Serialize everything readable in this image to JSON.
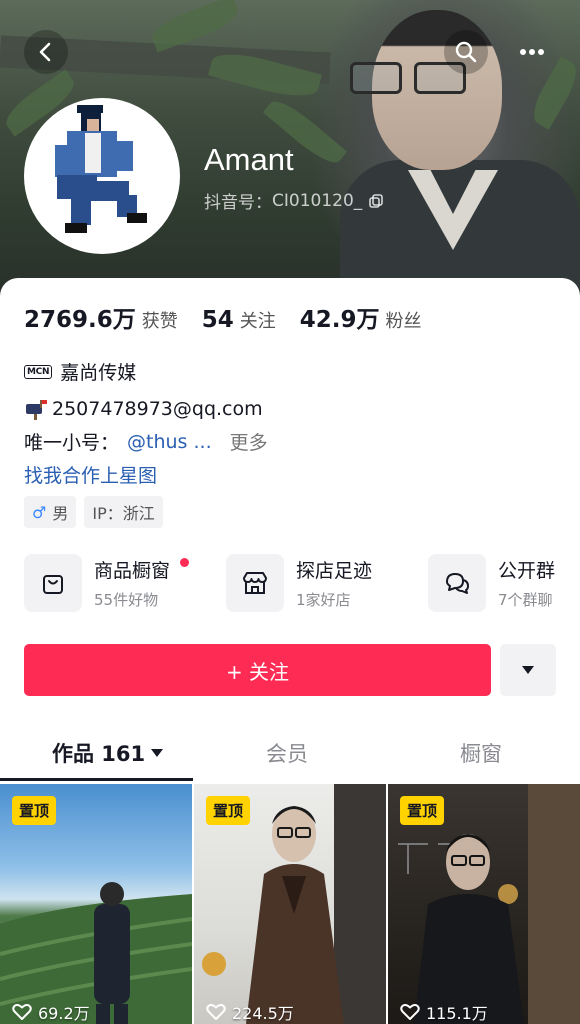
{
  "header": {
    "username": "Amant",
    "douyin_id_label": "抖音号：",
    "douyin_id": "CI010120_"
  },
  "stats": [
    {
      "value": "2769.6万",
      "label": "获赞"
    },
    {
      "value": "54",
      "label": "关注"
    },
    {
      "value": "42.9万",
      "label": "粉丝"
    }
  ],
  "bio": {
    "mcn_badge": "MCN",
    "mcn_name": "嘉尚传媒",
    "email": "2507478973@qq.com",
    "sub_account_label": "唯一小号：",
    "sub_account_handle": "@thus ...",
    "more_label": "更多",
    "xingtu_link": "找我合作上星图"
  },
  "tags": [
    {
      "icon": "male-icon",
      "icon_glyph": "♂",
      "label": "男"
    },
    {
      "label": "IP：浙江"
    }
  ],
  "shortcuts": [
    {
      "icon": "shopping-bag-icon",
      "title": "商品橱窗",
      "subtitle": "55件好物",
      "has_dot": true
    },
    {
      "icon": "shop-icon",
      "title": "探店足迹",
      "subtitle": "1家好店",
      "has_dot": false
    },
    {
      "icon": "chat-group-icon",
      "title": "公开群",
      "subtitle": "7个群聊",
      "has_dot": false
    }
  ],
  "actions": {
    "follow_label": "+ 关注"
  },
  "tabs": [
    {
      "label": "作品 161",
      "active": true
    },
    {
      "label": "会员",
      "active": false
    },
    {
      "label": "橱窗",
      "active": false
    }
  ],
  "videos": [
    {
      "pinned_label": "置顶",
      "likes": "69.2万"
    },
    {
      "pinned_label": "置顶",
      "likes": "224.5万"
    },
    {
      "pinned_label": "置顶",
      "likes": "115.1万"
    }
  ],
  "colors": {
    "accent": "#fe2c55",
    "link": "#2a5fb2",
    "pin": "#ffd200"
  }
}
